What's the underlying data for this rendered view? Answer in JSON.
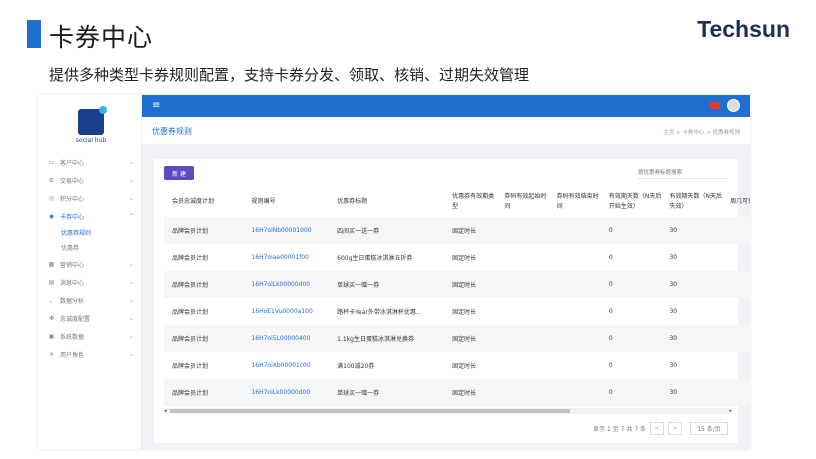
{
  "slide": {
    "title": "卡券中心",
    "subtitle": "提供多种类型卡券规则配置，支持卡券分发、领取、核销、过期失效管理",
    "brand": "Techsun"
  },
  "logo": {
    "text": "social hub"
  },
  "sidebar": {
    "items": [
      {
        "label": "客户中心",
        "icon": "monitor-icon"
      },
      {
        "label": "交易中心",
        "icon": "gear-icon"
      },
      {
        "label": "积分中心",
        "icon": "coin-icon"
      },
      {
        "label": "卡券中心",
        "icon": "coupon-icon"
      },
      {
        "label": "营销中心",
        "icon": "marketing-icon"
      },
      {
        "label": "消息中心",
        "icon": "message-icon"
      },
      {
        "label": "数据分析",
        "icon": "chart-icon"
      },
      {
        "label": "忠诚度配置",
        "icon": "puzzle-icon"
      },
      {
        "label": "系统数据",
        "icon": "database-icon"
      },
      {
        "label": "用户角色",
        "icon": "tools-icon"
      }
    ],
    "subitems": [
      {
        "label": "优惠券规则"
      },
      {
        "label": "优惠券"
      }
    ]
  },
  "header": {
    "page_title": "优惠券规则",
    "breadcrumb": "主页 > 卡券中心 > 优惠券规则"
  },
  "toolbar": {
    "new_label": "新 建",
    "search_placeholder": "按优惠券标题搜索"
  },
  "table": {
    "columns": [
      "会员忠诚度计划",
      "规则编号",
      "优惠券标题",
      "优惠券有效期类型",
      "券码有效起始时间",
      "券码有效结束时间",
      "有效期天数（N天后开始生效）",
      "有效期天数（N天后失效）",
      "周几可使"
    ],
    "rows": [
      [
        "品牌会员计划",
        "16H7oiNb00001000",
        "四间买一送一券",
        "固定时长",
        "",
        "",
        "0",
        "30",
        ""
      ],
      [
        "品牌会员计划",
        "16H7oiae00001f00",
        "600g生日蛋糕冰淇淋五折券",
        "固定时长",
        "",
        "",
        "0",
        "30",
        ""
      ],
      [
        "品牌会员计划",
        "16H7oiLk00000d00",
        "单球买一赠一券",
        "固定时长",
        "",
        "",
        "0",
        "30",
        ""
      ],
      [
        "品牌会员计划",
        "16HoE1Vu0000a100",
        "路杯卡Year外带冰淇淋杯优惠…",
        "固定时长",
        "",
        "",
        "0",
        "30",
        ""
      ],
      [
        "品牌会员计划",
        "16H7oi5L00000400",
        "1.1kg生日蛋糕冰淇淋兑换券",
        "固定时长",
        "",
        "",
        "0",
        "30",
        ""
      ],
      [
        "品牌会员计划",
        "16H7oiXb00001c00",
        "满100减20券",
        "固定时长",
        "",
        "",
        "0",
        "30",
        ""
      ],
      [
        "品牌会员计划",
        "16H7oiLk00000d00",
        "单球买一赠一券",
        "固定时长",
        "",
        "",
        "0",
        "30",
        ""
      ]
    ]
  },
  "pagination": {
    "summary": "显示 1 至 7 共 7 条",
    "prev": "<",
    "next": ">",
    "page_size": "15 条/页"
  },
  "colors": {
    "accent": "#1f6fd1",
    "button": "#5b4cc4"
  }
}
